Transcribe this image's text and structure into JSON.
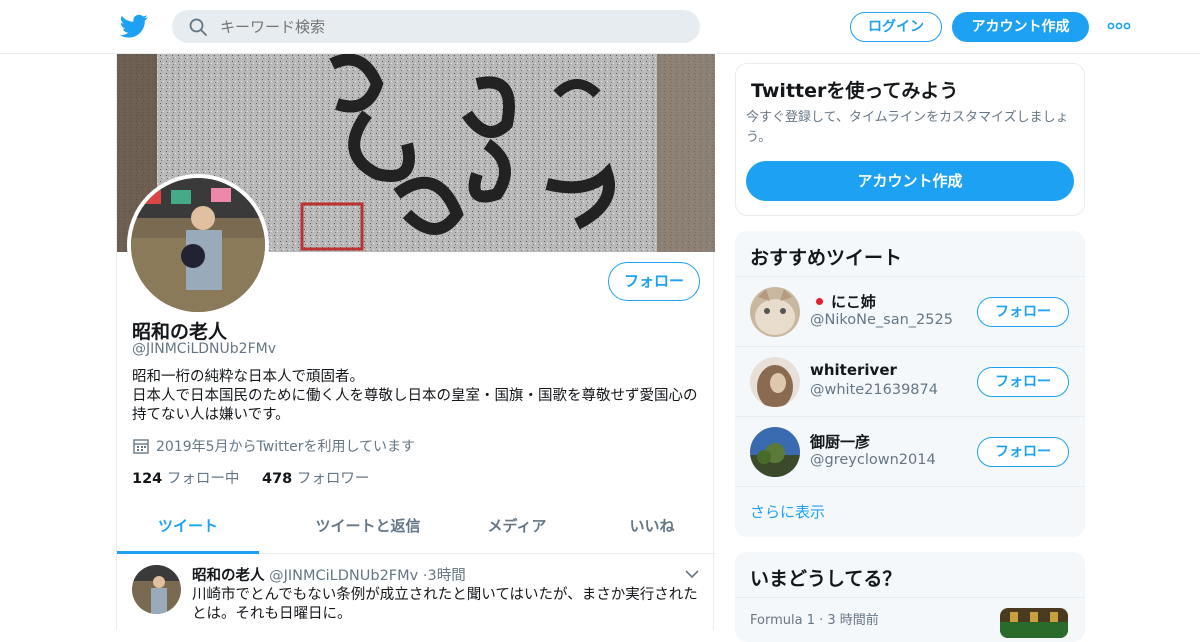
{
  "header": {
    "search_placeholder": "キーワード検索",
    "login_label": "ログイン",
    "signup_label": "アカウント作成"
  },
  "profile": {
    "name": "昭和の老人",
    "handle": "@JINMCiLDNUb2FMv",
    "follow_label": "フォロー",
    "bio_line1": "昭和一桁の純粋な日本人で頑固者。",
    "bio_line2": "日本人で日本国民のために働く人を尊敬し日本の皇室・国旗・国歌を尊敬せず愛国心の持てない人は嫌いです。",
    "joined": "2019年5月からTwitterを利用しています",
    "following_count": "124",
    "following_label": "フォロー中",
    "followers_count": "478",
    "followers_label": "フォロワー"
  },
  "tabs": [
    {
      "label": "ツイート"
    },
    {
      "label": "ツイートと返信"
    },
    {
      "label": "メディア"
    },
    {
      "label": "いいね"
    }
  ],
  "tweet": {
    "name": "昭和の老人",
    "handle": "@JINMCiLDNUb2FMv",
    "time": "3時間",
    "text": "川崎市でとんでもない条例が成立されたと聞いてはいたが、まさか実行されたとは。それも日曜日に。"
  },
  "signup_card": {
    "title": "Twitterを使ってみよう",
    "desc": "今すぐ登録して、タイムラインをカスタマイズしましょう。",
    "button": "アカウント作成"
  },
  "suggestions": {
    "title": "おすすめツイート",
    "items": [
      {
        "name": "にこ姉",
        "handle": "@NikoNe_san_2525",
        "follow": "フォロー"
      },
      {
        "name": "whiteriver",
        "handle": "@white21639874",
        "follow": "フォロー"
      },
      {
        "name": "御厨一彦",
        "handle": "@greyclown2014",
        "follow": "フォロー"
      }
    ],
    "more_label": "さらに表示"
  },
  "trends": {
    "title": "いまどうしてる？",
    "first_source": "Formula 1",
    "first_time": "3 時間前"
  },
  "colors": {
    "accent": "#1da1f2",
    "muted": "#657786",
    "border": "#e6ecf0",
    "panel": "#f5f8fa"
  }
}
